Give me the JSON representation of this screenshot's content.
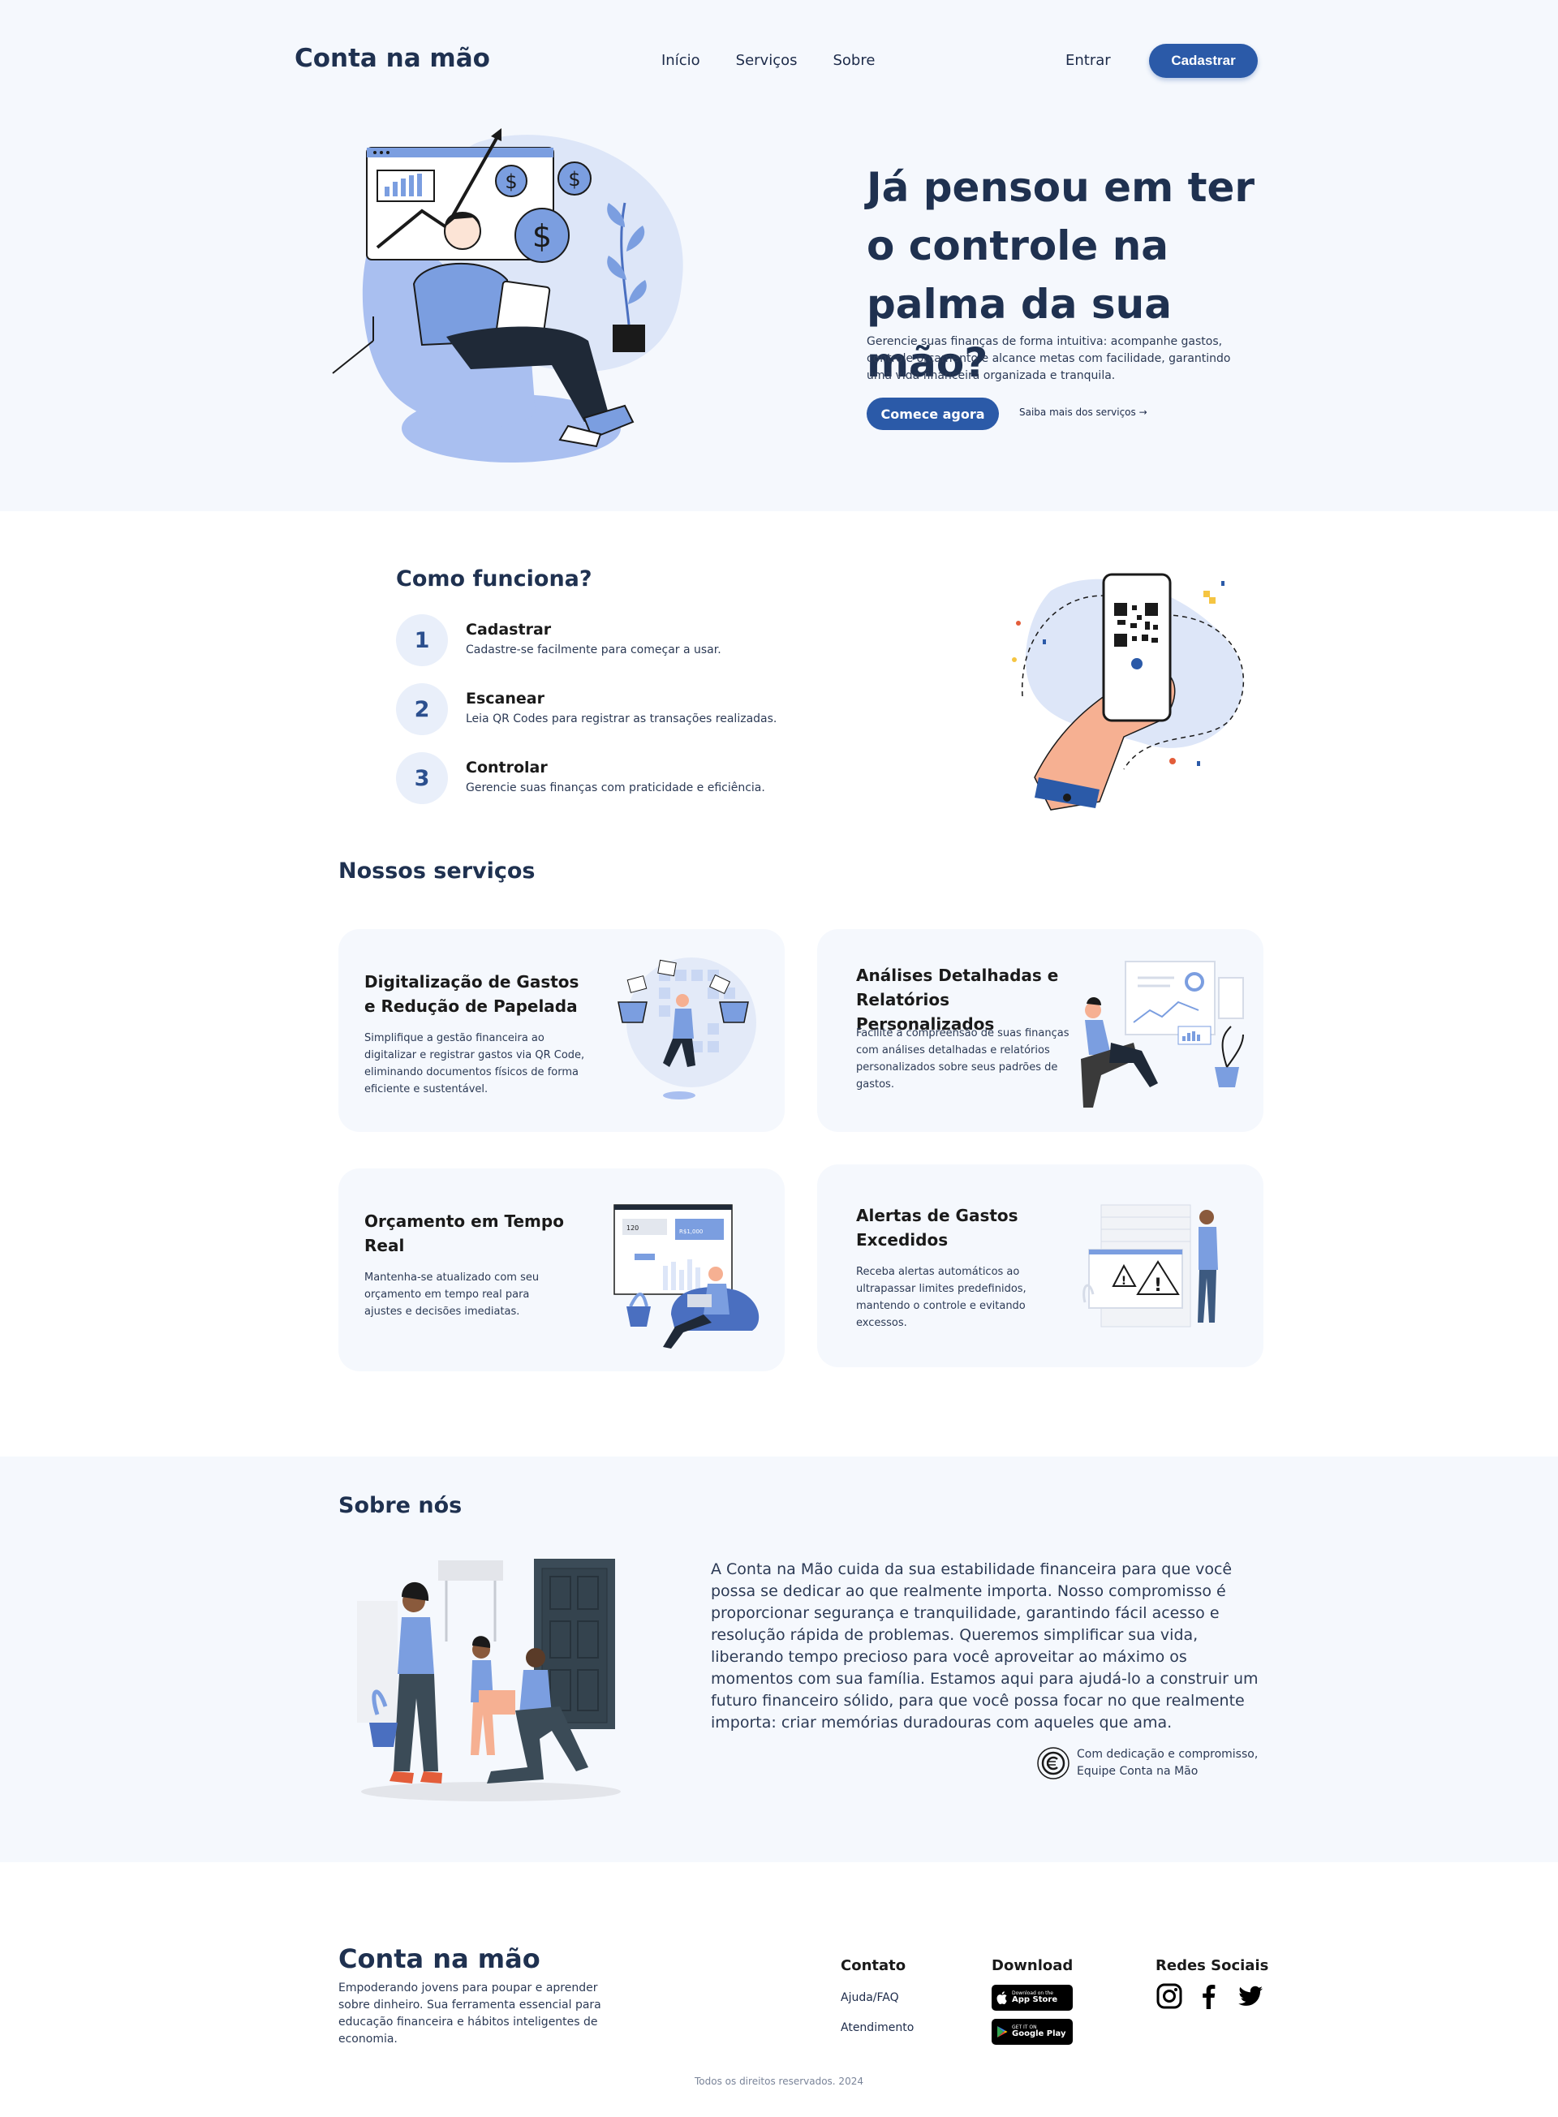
{
  "header": {
    "brand": "Conta na mão",
    "nav": [
      "Início",
      "Serviços",
      "Sobre"
    ],
    "login": "Entrar",
    "signup": "Cadastrar"
  },
  "hero": {
    "title": "Já pensou em ter o controle na palma da sua mão?",
    "description": "Gerencie suas finanças de forma intuitiva: acompanhe gastos, controle orçamento e alcance metas com facilidade, garantindo uma vida financeira organizada e tranquila.",
    "cta": "Comece agora",
    "learn_more": "Saiba mais dos serviços →"
  },
  "how": {
    "title": "Como funciona?",
    "steps": [
      {
        "num": "1",
        "title": "Cadastrar",
        "desc": "Cadastre-se facilmente para começar a usar."
      },
      {
        "num": "2",
        "title": "Escanear",
        "desc": "Leia QR Codes para registrar as transações realizadas."
      },
      {
        "num": "3",
        "title": "Controlar",
        "desc": "Gerencie suas finanças com praticidade e eficiência."
      }
    ]
  },
  "services": {
    "title": "Nossos serviços",
    "cards": [
      {
        "title": "Digitalização de Gastos e Redução de Papelada",
        "desc": "Simplifique a gestão financeira ao digitalizar e registrar gastos via QR Code, eliminando documentos físicos de forma eficiente e sustentável."
      },
      {
        "title": "Análises Detalhadas e Relatórios Personalizados",
        "desc": "Facilite a compreensão de suas finanças com análises detalhadas e relatórios personalizados sobre seus padrões de gastos."
      },
      {
        "title": "Orçamento em Tempo Real",
        "desc": "Mantenha-se atualizado com seu orçamento em tempo real para ajustes e decisões imediatas.",
        "art_values": [
          "120",
          "R$1,000"
        ]
      },
      {
        "title": "Alertas de Gastos Excedidos",
        "desc": "Receba alertas automáticos ao ultrapassar limites predefinidos, mantendo o controle e evitando excessos."
      }
    ]
  },
  "about": {
    "title": "Sobre nós",
    "text": "A Conta na Mão cuida da sua estabilidade financeira para que você possa se dedicar ao que realmente importa. Nosso compromisso é proporcionar segurança e tranquilidade, garantindo fácil acesso e resolução rápida de problemas. Queremos simplificar sua vida, liberando tempo precioso para você aproveitar ao máximo os momentos com sua família. Estamos aqui para ajudá-lo a construir um futuro financeiro sólido, para que você possa focar no que realmente importa: criar memórias duradouras com aqueles que ama.",
    "sign_line1": "Com dedicação e compromisso,",
    "sign_line2": "Equipe Conta na Mão"
  },
  "footer": {
    "brand": "Conta na mão",
    "tagline": "Empoderando jovens para poupar e aprender sobre dinheiro. Sua ferramenta essencial para educação financeira e hábitos inteligentes de economia.",
    "contact_title": "Contato",
    "contact_links": [
      "Ajuda/FAQ",
      "Atendimento"
    ],
    "download_title": "Download",
    "app_store_small": "Download on the",
    "app_store": "App Store",
    "google_play_small": "GET IT ON",
    "google_play": "Google Play",
    "social_title": "Redes Sociais",
    "copyright": "Todos os direitos reservados. 2024"
  },
  "colors": {
    "primary": "#2b5aa8",
    "heading": "#1f3150",
    "section_bg": "#f5f8fd",
    "illustration": "#7b9ee0"
  },
  "icons": [
    "instagram-icon",
    "facebook-icon",
    "twitter-icon",
    "apple-icon",
    "google-play-icon",
    "coin-seal-icon"
  ]
}
